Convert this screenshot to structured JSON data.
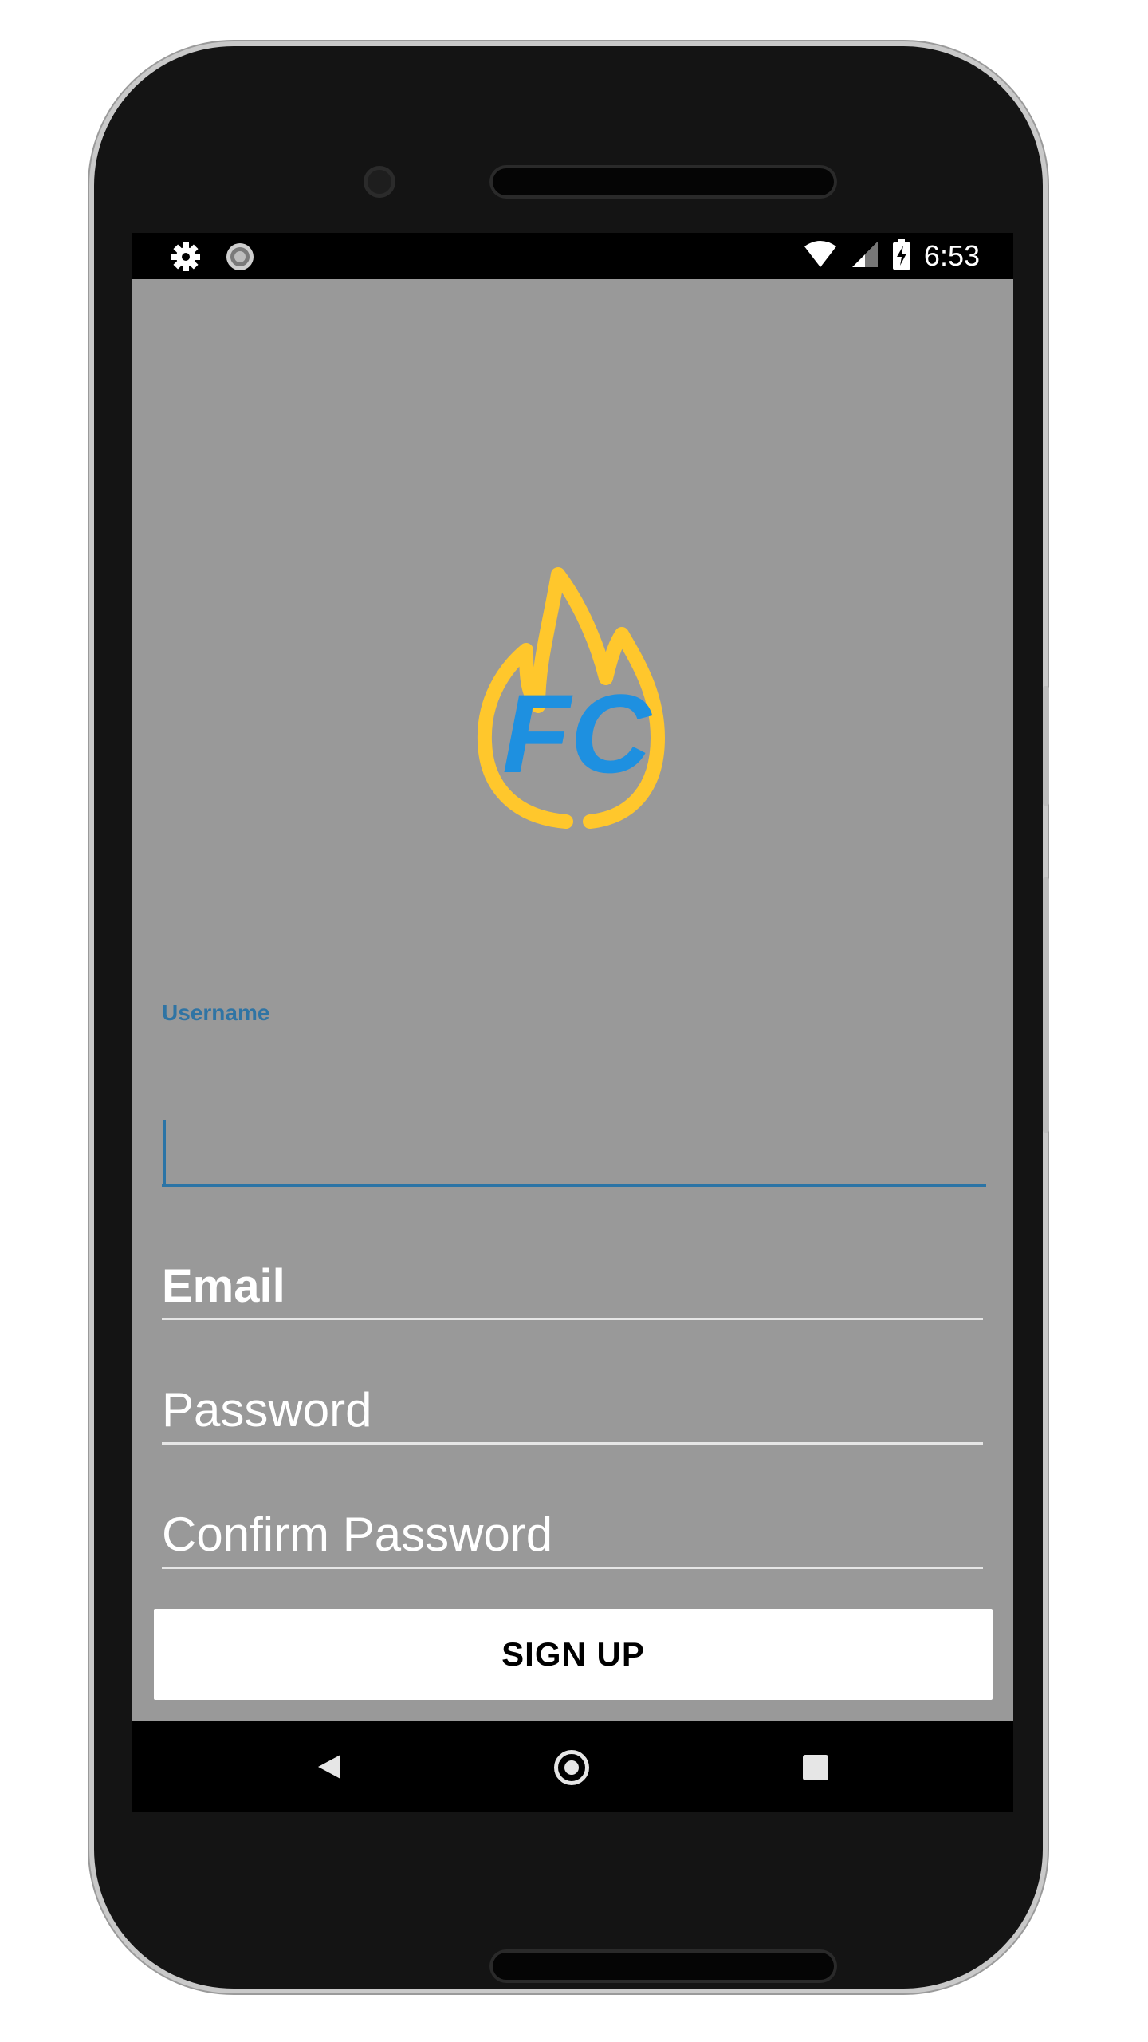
{
  "status_bar": {
    "time": "6:53",
    "left_icons": [
      "gear-icon",
      "sync-icon"
    ],
    "right_icons": [
      "wifi-icon",
      "signal-icon",
      "battery-charging-icon"
    ]
  },
  "logo": {
    "text": "FC",
    "flame_color": "#FFC72C",
    "text_color": "#1E90E0"
  },
  "form": {
    "username_label": "Username",
    "username_value": "",
    "email_placeholder": "Email",
    "password_placeholder": "Password",
    "confirm_password_placeholder": "Confirm Password",
    "signup_label": "SIGN UP"
  },
  "nav_bar": {
    "icons": [
      "back-icon",
      "home-icon",
      "recents-icon"
    ]
  },
  "colors": {
    "screen_bg": "#999999",
    "accent": "#2B74A6",
    "button_bg": "#FFFFFF"
  }
}
